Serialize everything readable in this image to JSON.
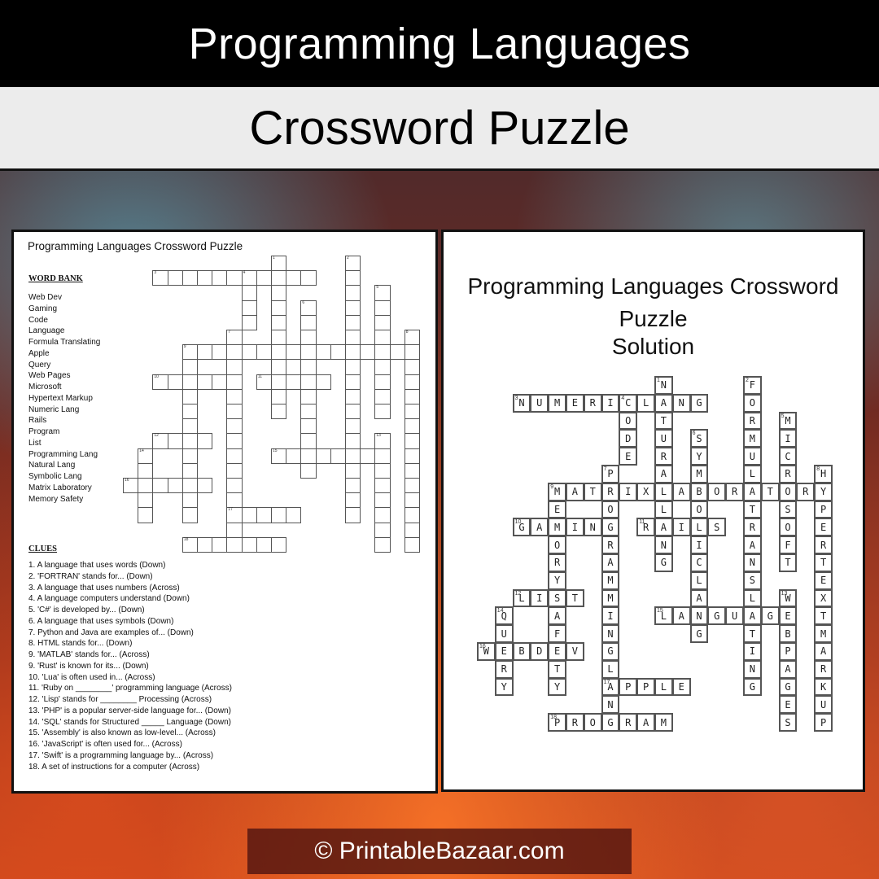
{
  "header": {
    "title": "Programming Languages",
    "subtitle": "Crossword Puzzle"
  },
  "puzzle_sheet": {
    "title": "Programming Languages Crossword Puzzle",
    "word_bank_heading": "WORD BANK",
    "word_bank": [
      "Web Dev",
      "Gaming",
      "Code",
      "Language",
      "Formula Translating",
      "Apple",
      "Query",
      "Web Pages",
      "Microsoft",
      "Hypertext Markup",
      "Numeric Lang",
      "Rails",
      "Program",
      "List",
      "Programming Lang",
      "Natural Lang",
      "Symbolic Lang",
      "Matrix Laboratory",
      "Memory Safety"
    ],
    "clues_heading": "CLUES",
    "clues": [
      "1. A language that uses words (Down)",
      "2. 'FORTRAN' stands for... (Down)",
      "3. A language that uses numbers (Across)",
      "4. A language computers understand (Down)",
      "5. 'C#' is developed by... (Down)",
      "6. A language that uses symbols (Down)",
      "7. Python and Java are examples of... (Down)",
      "8. HTML stands for... (Down)",
      "9. 'MATLAB' stands for... (Across)",
      "9. 'Rust' is known for its... (Down)",
      "10. 'Lua' is often used in... (Across)",
      "11. 'Ruby on ________' programming language (Across)",
      "12. 'Lisp' stands for ________ Processing (Across)",
      "13. 'PHP' is a popular server-side language for... (Down)",
      "14. 'SQL' stands for Structured _____ Language (Down)",
      "15. 'Assembly' is also known as low-level... (Across)",
      "16. 'JavaScript' is often used for... (Across)",
      "17. 'Swift' is a programming language by... (Across)",
      "18. A set of instructions for a computer (Across)"
    ]
  },
  "solution_sheet": {
    "title": "Programming Languages Crossword Puzzle",
    "subtitle": "Solution"
  },
  "crossword": {
    "words": [
      {
        "num": 1,
        "answer": "NATURALLANG",
        "dir": "down",
        "row": 0,
        "col": 10
      },
      {
        "num": 2,
        "answer": "FORMULATRANSLATING",
        "dir": "down",
        "row": 0,
        "col": 15
      },
      {
        "num": 3,
        "answer": "NUMERICLANG",
        "dir": "across",
        "row": 1,
        "col": 2
      },
      {
        "num": 4,
        "answer": "CODE",
        "dir": "down",
        "row": 1,
        "col": 8
      },
      {
        "num": 5,
        "answer": "MICROSOFT",
        "dir": "down",
        "row": 2,
        "col": 17
      },
      {
        "num": 6,
        "answer": "SYMBOLICLANG",
        "dir": "down",
        "row": 3,
        "col": 12
      },
      {
        "num": 7,
        "answer": "PROGRAMMINGLANG",
        "dir": "down",
        "row": 5,
        "col": 7
      },
      {
        "num": 8,
        "answer": "HYPERTEXTMARKUP",
        "dir": "down",
        "row": 5,
        "col": 19
      },
      {
        "num": 9,
        "answer": "MATRIXLABORATORY",
        "dir": "across",
        "row": 6,
        "col": 4
      },
      {
        "num": 9,
        "answer": "MEMORYSAFETY",
        "dir": "down",
        "row": 6,
        "col": 4
      },
      {
        "num": 10,
        "answer": "GAMING",
        "dir": "across",
        "row": 8,
        "col": 2
      },
      {
        "num": 11,
        "answer": "RAILS",
        "dir": "across",
        "row": 8,
        "col": 9
      },
      {
        "num": 12,
        "answer": "LIST",
        "dir": "across",
        "row": 12,
        "col": 2
      },
      {
        "num": 13,
        "answer": "WEBPAGES",
        "dir": "down",
        "row": 12,
        "col": 17
      },
      {
        "num": 14,
        "answer": "QUERY",
        "dir": "down",
        "row": 13,
        "col": 1
      },
      {
        "num": 15,
        "answer": "LANGUAGE",
        "dir": "across",
        "row": 13,
        "col": 10
      },
      {
        "num": 16,
        "answer": "WEBDEV",
        "dir": "across",
        "row": 15,
        "col": 0
      },
      {
        "num": 17,
        "answer": "APPLE",
        "dir": "across",
        "row": 17,
        "col": 7
      },
      {
        "num": 18,
        "answer": "PROGRAM",
        "dir": "across",
        "row": 19,
        "col": 4
      }
    ]
  },
  "footer": {
    "copyright": "© PrintableBazaar.com"
  }
}
